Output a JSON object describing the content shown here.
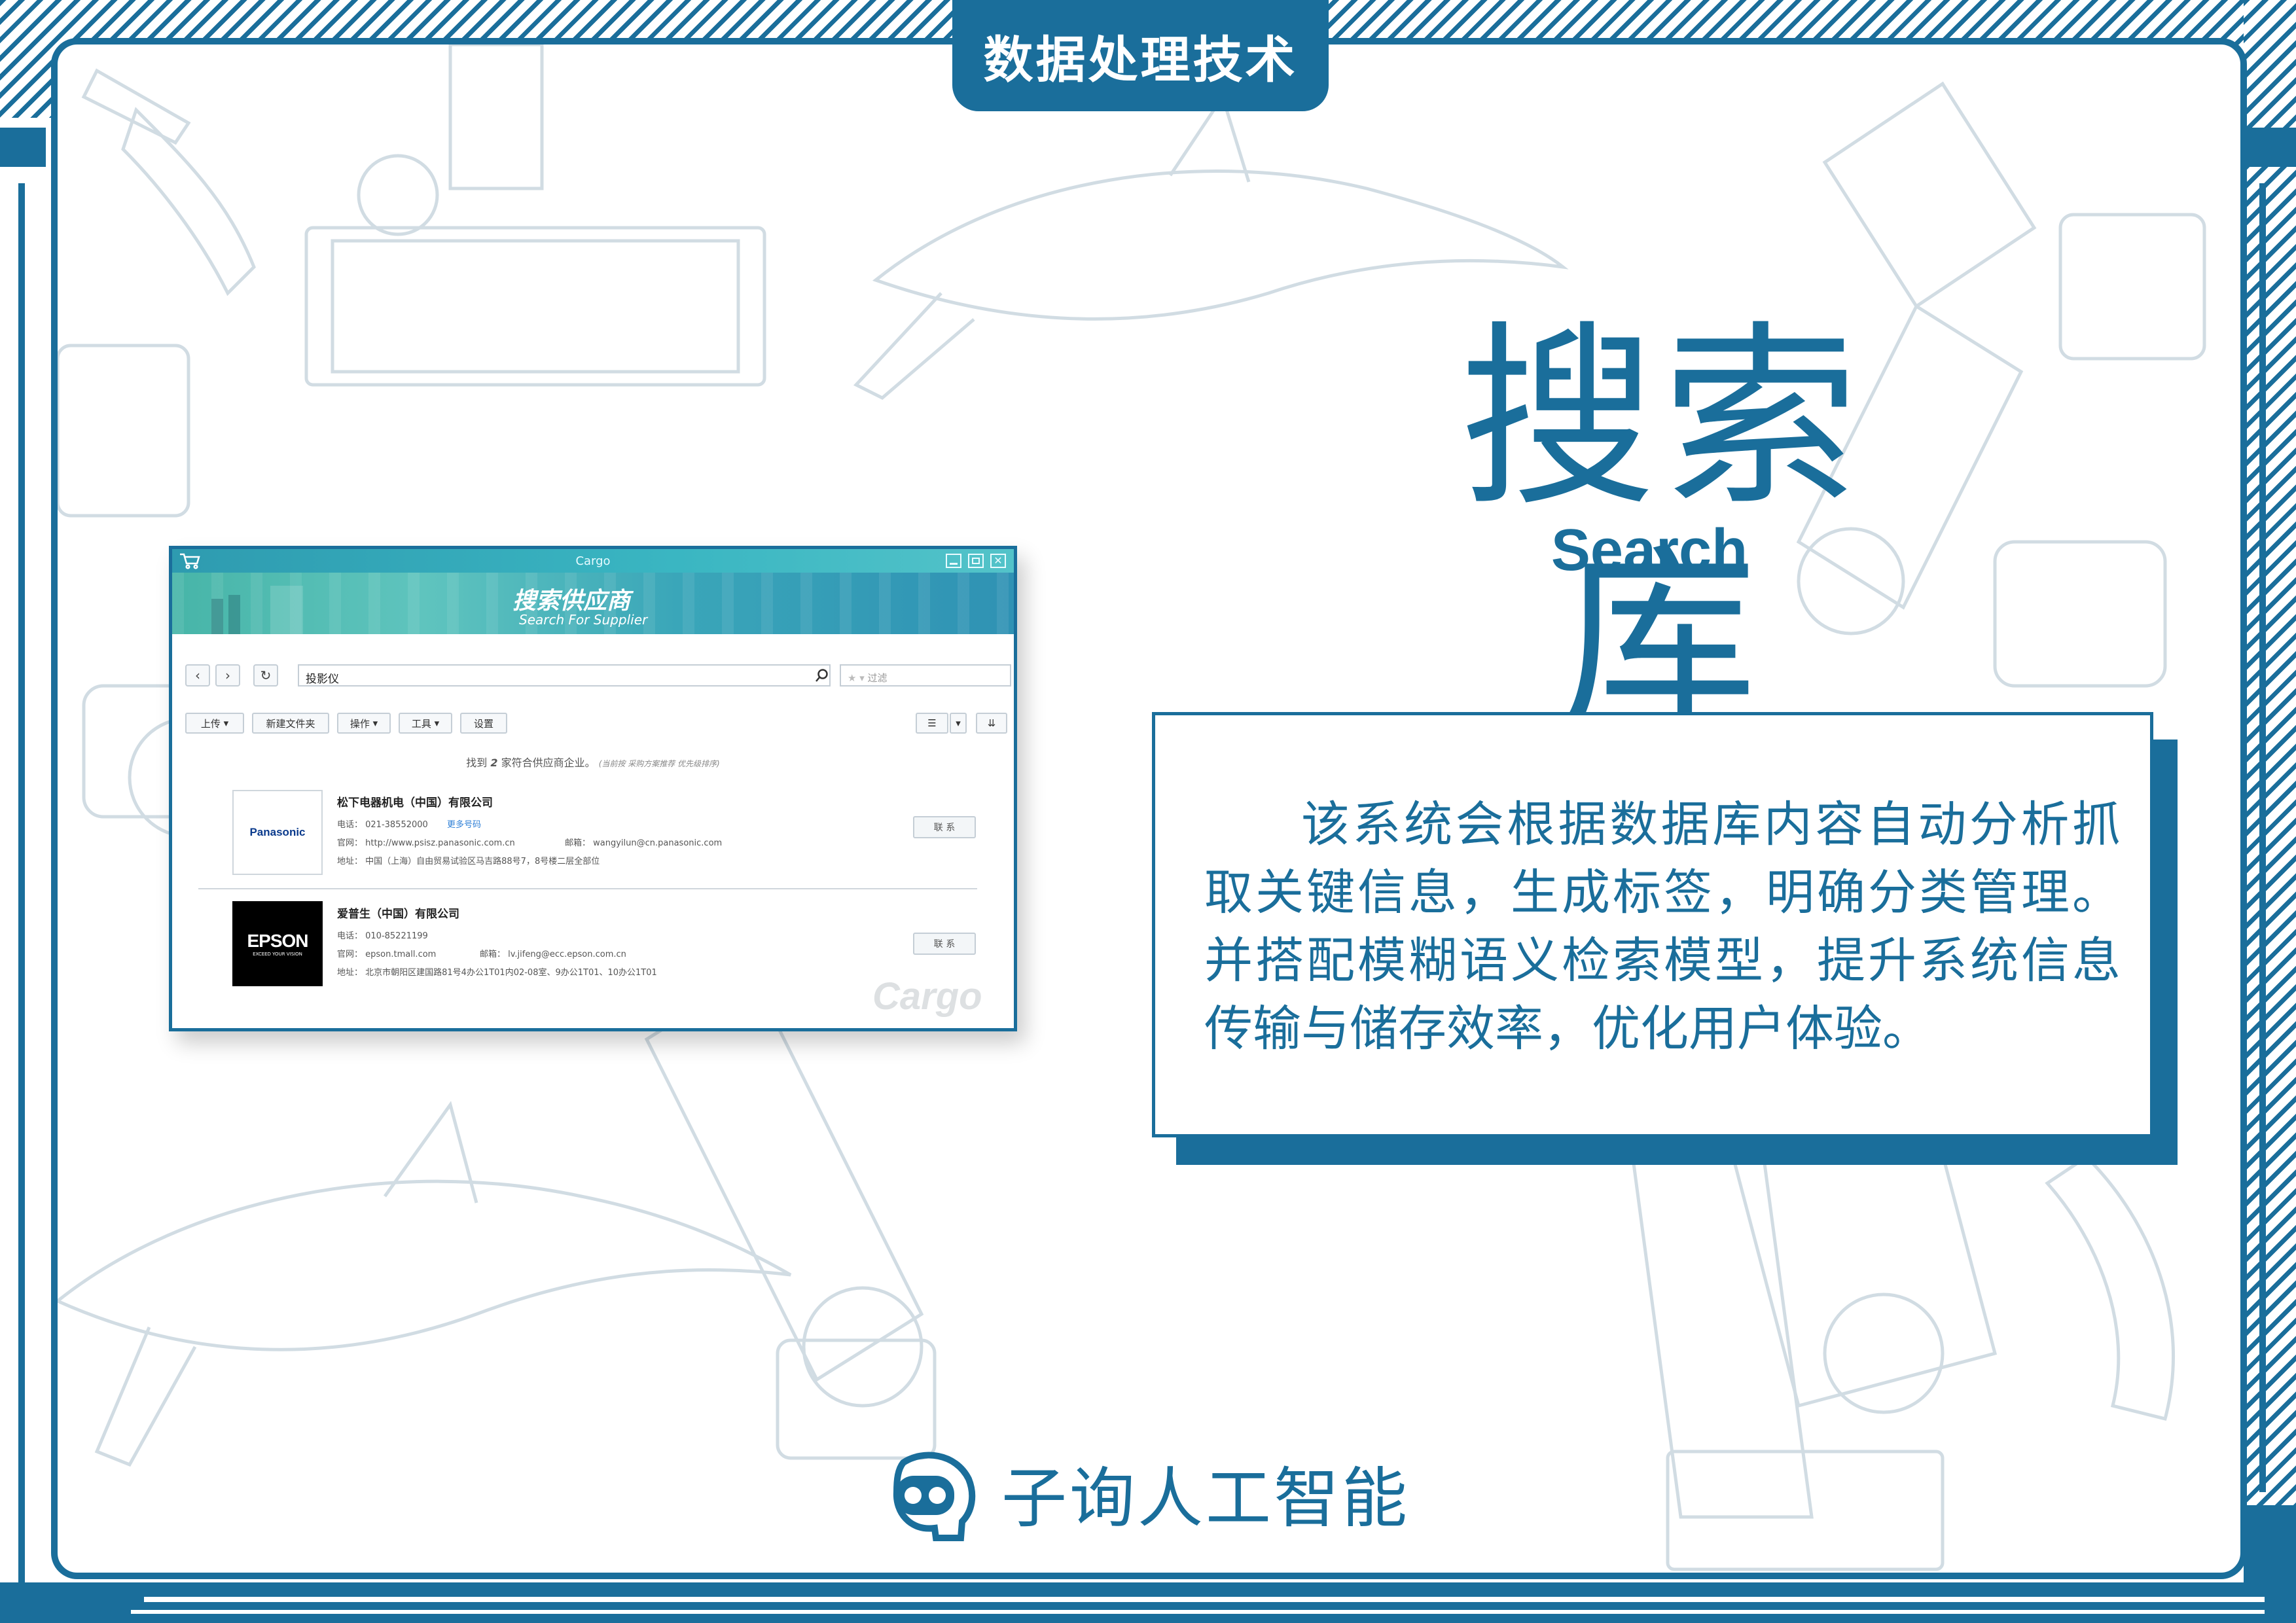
{
  "header": {
    "tab_label": "数据处理技术"
  },
  "title": {
    "main": "搜索库",
    "sub": "Search"
  },
  "description": "该系统会根据数据库内容自动分析抓取关键信息，生成标签，明确分类管理。并搭配模糊语义检索模型，提升系统信息传输与储存效率，优化用户体验。",
  "screenshot": {
    "window_title": "Cargo",
    "banner": {
      "title": "搜索供应商",
      "subtitle": "Search For Supplier"
    },
    "search": {
      "value": "投影仪",
      "filter_placeholder": "过滤"
    },
    "toolbar": [
      "上传",
      "新建文件夹",
      "操作",
      "工具",
      "设置"
    ],
    "result_summary": {
      "prefix": "找到",
      "count": "2",
      "suffix": "家符合供应商企业。",
      "note": "(当前按 采购方案推荐 优先级排序)"
    },
    "companies": [
      {
        "logo_text": "Panasonic",
        "name": "松下电器机电（中国）有限公司",
        "phone": "电话： 021-38552000",
        "more_numbers": "更多号码",
        "website": "官网： http://www.psisz.panasonic.com.cn",
        "email": "邮箱： wangyilun@cn.panasonic.com",
        "address": "地址： 中国（上海）自由贸易试验区马吉路88号7，8号楼二层全部位",
        "contact_label": "联 系"
      },
      {
        "logo_text": "EPSON",
        "logo_tagline": "EXCEED YOUR VISION",
        "name": "爱普生（中国）有限公司",
        "phone": "电话： 010-85221199",
        "website": "官网： epson.tmall.com",
        "email": "邮箱： lv.jifeng@ecc.epson.com.cn",
        "address": "地址： 北京市朝阳区建国路81号4办公1T01内02-08室、9办公1T01、10办公1T01",
        "contact_label": "联 系"
      }
    ],
    "watermark": "Cargo"
  },
  "brand": {
    "name": "子询人工智能"
  },
  "colors": {
    "primary": "#1a6e9b",
    "window_accent": "#3ab6c2",
    "background": "#ffffff"
  }
}
